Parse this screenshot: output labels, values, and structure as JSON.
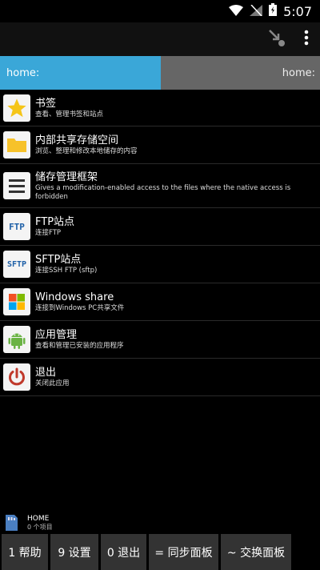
{
  "status_bar": {
    "time": "5:07"
  },
  "toolbar": {
    "icons": [
      "move-icon",
      "overflow-menu-icon"
    ]
  },
  "tabs": {
    "left": "home:",
    "right": "home:"
  },
  "items": [
    {
      "title": "书签",
      "subtitle": "查看、管理书签和站点",
      "icon": "star-icon"
    },
    {
      "title": "内部共享存储空间",
      "subtitle": "浏览、整理和修改本地储存的内容",
      "icon": "folder-icon"
    },
    {
      "title": "储存管理框架",
      "subtitle": "Gives a modification-enabled access to the files where the native access is forbidden",
      "icon": "menu-lines-icon"
    },
    {
      "title": "FTP站点",
      "subtitle": "连接FTP",
      "icon": "ftp-icon",
      "icon_text": "FTP"
    },
    {
      "title": "SFTP站点",
      "subtitle": "连接SSH FTP (sftp)",
      "icon": "sftp-icon",
      "icon_text": "SFTP"
    },
    {
      "title": "Windows share",
      "subtitle": "连接到Windows PC共享文件",
      "icon": "windows-icon"
    },
    {
      "title": "应用管理",
      "subtitle": "查看和管理已安装的应用程序",
      "icon": "android-icon"
    },
    {
      "title": "退出",
      "subtitle": "关闭此应用",
      "icon": "power-icon"
    }
  ],
  "footer": {
    "title": "HOME",
    "subtitle": "0 个项目"
  },
  "bottom_buttons": [
    {
      "label": "1 帮助"
    },
    {
      "label": "9 设置"
    },
    {
      "label": "0 退出"
    },
    {
      "label": "= 同步面板"
    },
    {
      "label": "~ 交换面板"
    }
  ]
}
